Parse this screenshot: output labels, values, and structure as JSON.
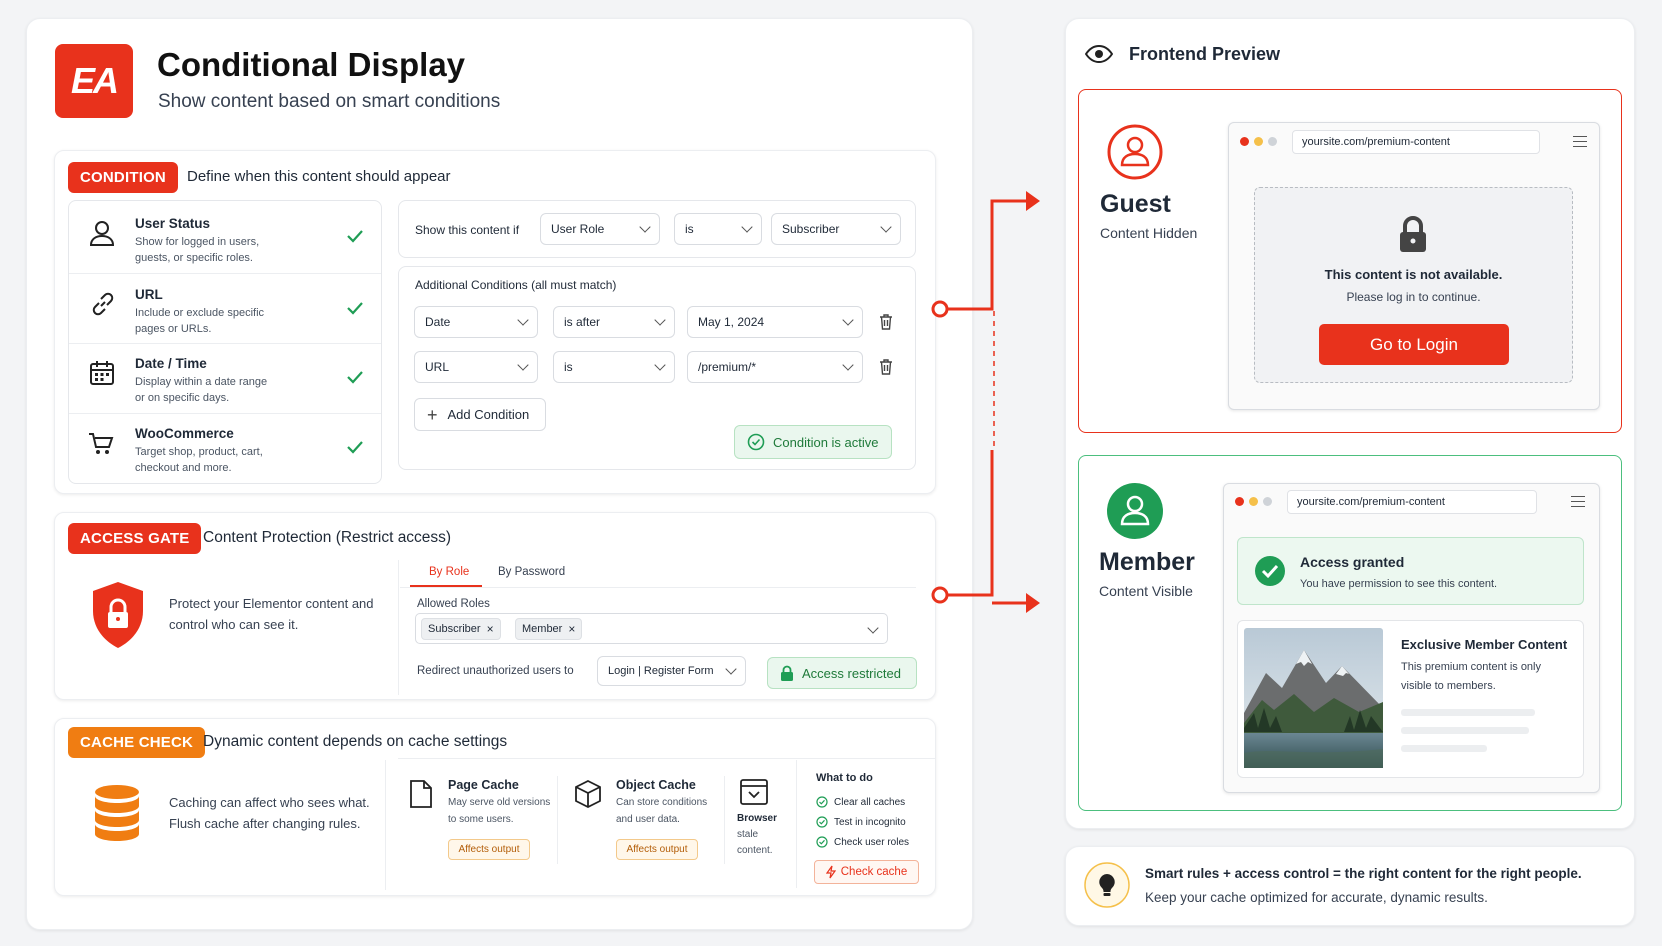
{
  "header": {
    "logo_text": "EA",
    "title": "Conditional Display",
    "subtitle": "Show content based on smart conditions"
  },
  "condition": {
    "tag": "CONDITION",
    "heading": "Define when this content should appear",
    "types": [
      {
        "title": "User Status",
        "desc1": "Show for logged in users,",
        "desc2": "guests, or specific roles.",
        "icon": "user-icon"
      },
      {
        "title": "URL",
        "desc1": "Include or exclude specific",
        "desc2": "pages or URLs.",
        "icon": "link-icon"
      },
      {
        "title": "Date / Time",
        "desc1": "Display within a date range",
        "desc2": "or on specific days.",
        "icon": "calendar-icon"
      },
      {
        "title": "WooCommerce",
        "desc1": "Target shop, product, cart,",
        "desc2": "checkout and more.",
        "icon": "cart-icon"
      }
    ],
    "show_if_label": "Show this content if",
    "rule": {
      "field": "User Role",
      "operator": "is",
      "value": "Subscriber"
    },
    "additional_label": "Additional Conditions (all must match)",
    "additional": [
      {
        "field": "Date",
        "operator": "is after",
        "value": "May 1, 2024"
      },
      {
        "field": "URL",
        "operator": "is",
        "value": "/premium/*"
      }
    ],
    "add_label": "Add Condition",
    "active_label": "Condition is active"
  },
  "access": {
    "tag": "ACCESS GATE",
    "heading": "Content Protection (Restrict access)",
    "desc1": "Protect your Elementor content and",
    "desc2": "control who can see it.",
    "tabs": [
      "By Role",
      "By Password"
    ],
    "allowed_label": "Allowed Roles",
    "roles": [
      "Subscriber",
      "Member"
    ],
    "redirect_label": "Redirect unauthorized users to",
    "redirect_value": "Login | Register Form",
    "restricted_label": "Access restricted"
  },
  "cache": {
    "tag": "CACHE CHECK",
    "heading": "Dynamic content depends on cache settings",
    "desc1": "Caching can affect who sees what.",
    "desc2": "Flush cache after changing rules.",
    "page_cache": {
      "title": "Page Cache",
      "d1": "May serve old versions",
      "d2": "to some users.",
      "badge": "Affects output"
    },
    "object_cache": {
      "title": "Object Cache",
      "d1": "Can store conditions",
      "d2": "and user data.",
      "badge": "Affects output"
    },
    "browser": {
      "l1": "Browser",
      "l2": "stale",
      "l3": "content."
    },
    "todo_title": "What to do",
    "todo": [
      "Clear all caches",
      "Test in incognito",
      "Check user roles"
    ],
    "check_btn": "Check cache"
  },
  "preview": {
    "title": "Frontend Preview",
    "url": "yoursite.com/premium-content",
    "guest": {
      "name": "Guest",
      "state": "Content Hidden",
      "msg1": "This content is not available.",
      "msg2": "Please log in to continue.",
      "button": "Go to Login"
    },
    "member": {
      "name": "Member",
      "state": "Content Visible",
      "granted_title": "Access granted",
      "granted_desc": "You have permission to see this content.",
      "content_title": "Exclusive Member Content",
      "content_d1": "This premium content is only",
      "content_d2": "visible to members."
    }
  },
  "footer": {
    "line1": "Smart rules + access control = the right content for the right people.",
    "line2": "Keep your cache optimized for accurate, dynamic results."
  },
  "colors": {
    "accent": "#e8321c",
    "green": "#1f9d55",
    "orange": "#f07d12"
  }
}
